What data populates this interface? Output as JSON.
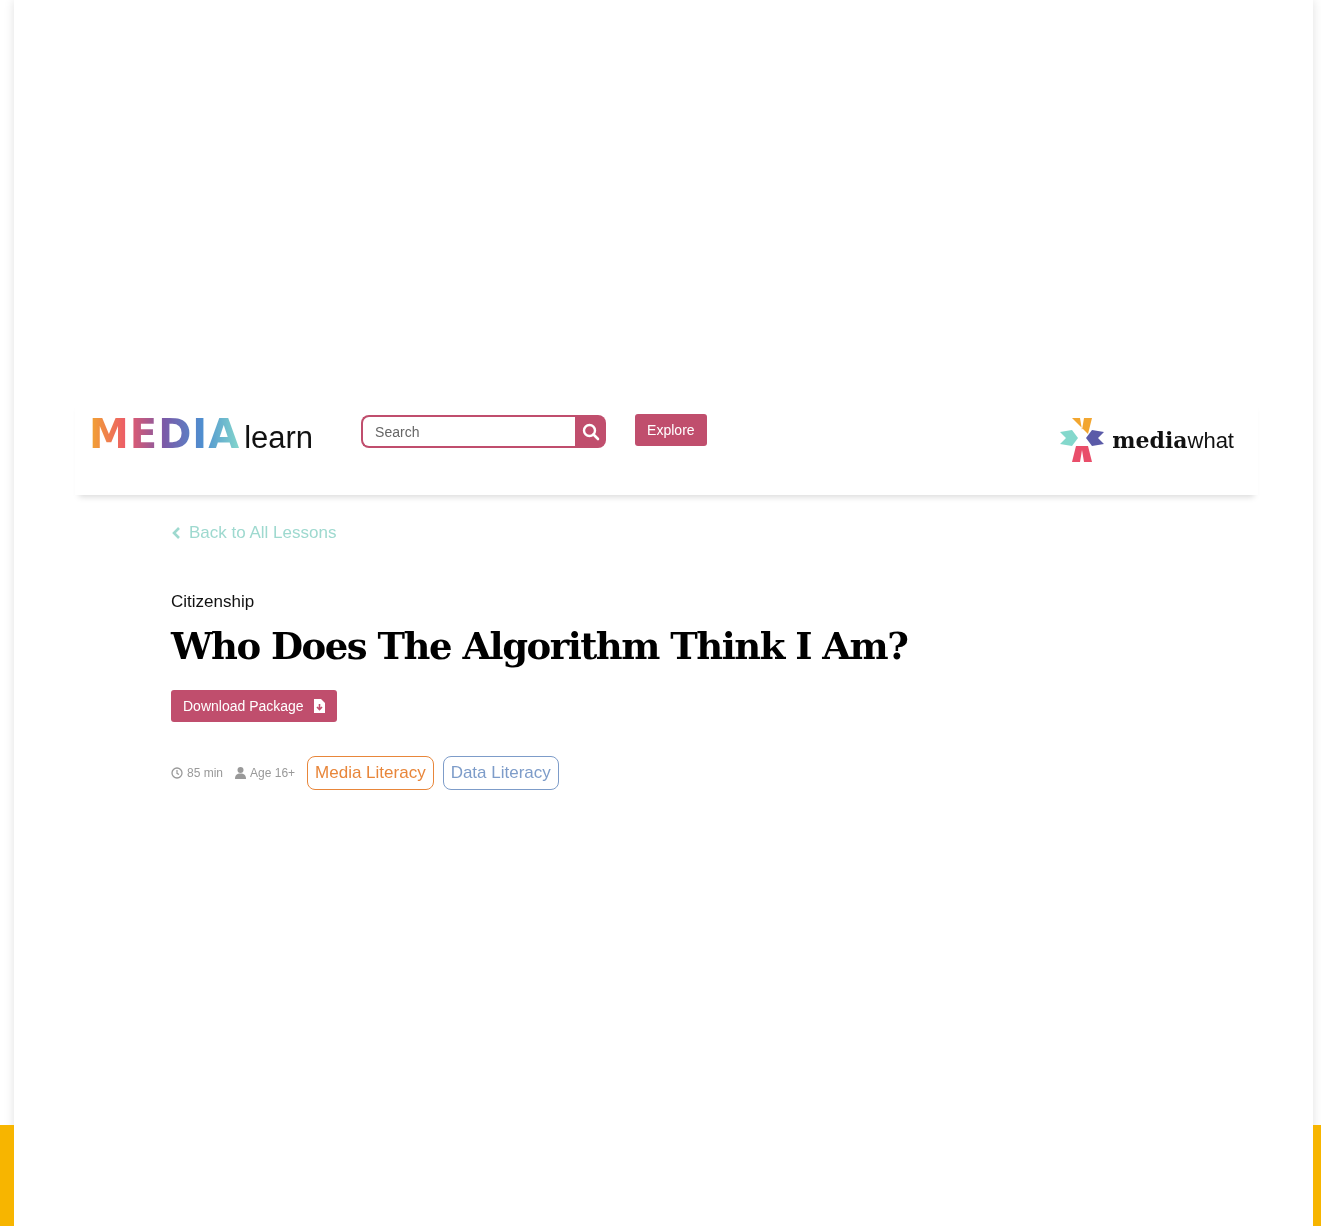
{
  "header": {
    "logo": {
      "part_1": "MEDIA",
      "part_2": "learn"
    },
    "search": {
      "placeholder": "Search"
    },
    "explore_button": "Explore",
    "partner_logo": {
      "part_1": "media",
      "part_2": "what"
    }
  },
  "back_link": "Back to All Lessons",
  "category": "Citizenship",
  "title": "Who Does The Algorithm Think I Am?",
  "download_button": "Download Package",
  "meta": [
    {
      "kind": "duration",
      "text": "85 min"
    },
    {
      "kind": "age",
      "text": "Age 16+"
    }
  ],
  "tags": [
    {
      "label": "Media Literacy",
      "color": "#e8863a"
    },
    {
      "label": "Data Literacy",
      "color": "#7d9cc9"
    }
  ]
}
